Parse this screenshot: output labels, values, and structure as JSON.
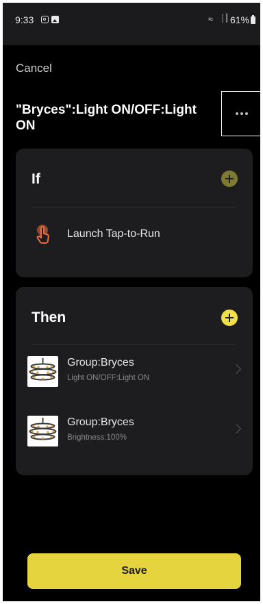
{
  "status_bar": {
    "time": "9:33",
    "battery": "61%",
    "icons": [
      "instagram-icon",
      "gallery-icon",
      "wifi-icon",
      "signal-icon",
      "battery-icon"
    ]
  },
  "header": {
    "cancel_label": "Cancel",
    "title": "\"Bryces\":Light ON/OFF:Light ON",
    "more_label": "more-options"
  },
  "if_section": {
    "heading": "If",
    "condition": {
      "icon": "tap-hand-icon",
      "label": "Launch Tap-to-Run"
    }
  },
  "then_section": {
    "heading": "Then",
    "actions": [
      {
        "title": "Group:Bryces",
        "subtitle": "Light ON/OFF:Light ON",
        "icon": "chandelier-thumbnail"
      },
      {
        "title": "Group:Bryces",
        "subtitle": "Brightness:100%",
        "icon": "chandelier-thumbnail"
      }
    ]
  },
  "footer": {
    "save_label": "Save"
  },
  "colors": {
    "accent": "#e6d43f",
    "card_bg": "#1d1d1f",
    "tap_icon": "#f26b3a"
  }
}
